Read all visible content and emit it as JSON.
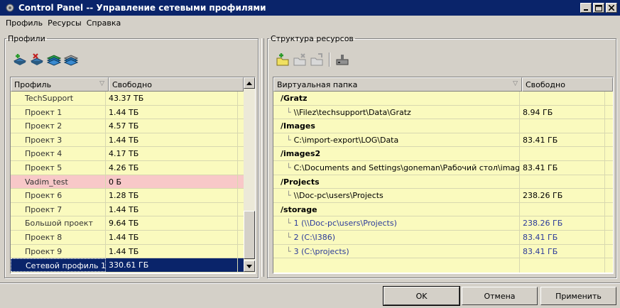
{
  "window": {
    "title": "Control Panel -- Управление сетевыми профилями"
  },
  "menu": [
    "Профиль",
    "Ресурсы",
    "Справка"
  ],
  "profiles_group": {
    "legend": "Профили",
    "columns": [
      "Профиль",
      "Свободно"
    ],
    "rows": [
      {
        "name": "TechSupport",
        "free": "43.37 ТБ"
      },
      {
        "name": "Проект 1",
        "free": "1.44 ТБ"
      },
      {
        "name": "Проект 2",
        "free": "4.57 ТБ"
      },
      {
        "name": "Проект 3",
        "free": "1.44 ТБ"
      },
      {
        "name": "Проект 4",
        "free": "4.17 ТБ"
      },
      {
        "name": "Проект 5",
        "free": "4.26 ТБ"
      },
      {
        "name": "Vadim_test",
        "free": "0 Б"
      },
      {
        "name": "Проект 6",
        "free": "1.28 ТБ"
      },
      {
        "name": "Проект 7",
        "free": "1.44 ТБ"
      },
      {
        "name": "Большой проект",
        "free": "9.64 ТБ"
      },
      {
        "name": "Проект 8",
        "free": "1.44 ТБ"
      },
      {
        "name": "Проект 9",
        "free": "1.44 ТБ"
      },
      {
        "name": "Сетевой профиль 1",
        "free": "330.61 ГБ"
      }
    ]
  },
  "resources_group": {
    "legend": "Структура ресурсов",
    "columns": [
      "Виртуальная папка",
      "Свободно"
    ],
    "rows": [
      {
        "folder": "/Gratz",
        "free": ""
      },
      {
        "path": "\\\\Filez\\techsupport\\Data\\Gratz",
        "free": "8.94 ГБ"
      },
      {
        "folder": "/Images",
        "free": ""
      },
      {
        "path": "C:\\import-export\\LOG\\Data",
        "free": "83.41 ГБ"
      },
      {
        "folder": "/images2",
        "free": ""
      },
      {
        "path": "C:\\Documents and Settings\\goneman\\Рабочий стол\\images",
        "free": "83.41 ГБ"
      },
      {
        "folder": "/Projects",
        "free": ""
      },
      {
        "path": "\\\\Doc-pc\\users\\Projects",
        "free": "238.26 ГБ"
      },
      {
        "folder": "/storage",
        "free": ""
      },
      {
        "path": "1 (\\\\Doc-pc\\users\\Projects)",
        "free": "238.26 ГБ"
      },
      {
        "path": "2 (C:\\I386)",
        "free": "83.41 ГБ"
      },
      {
        "path": "3 (C:\\projects)",
        "free": "83.41 ГБ"
      }
    ]
  },
  "buttons": {
    "ok": "OK",
    "cancel": "Отмена",
    "apply": "Применить"
  },
  "colors": {
    "titlebar": "#0a246a",
    "row": "#fafabe",
    "pink_row": "#f8c8c8",
    "selected": "#0a246a",
    "path_blue": "#2b3a9a"
  }
}
